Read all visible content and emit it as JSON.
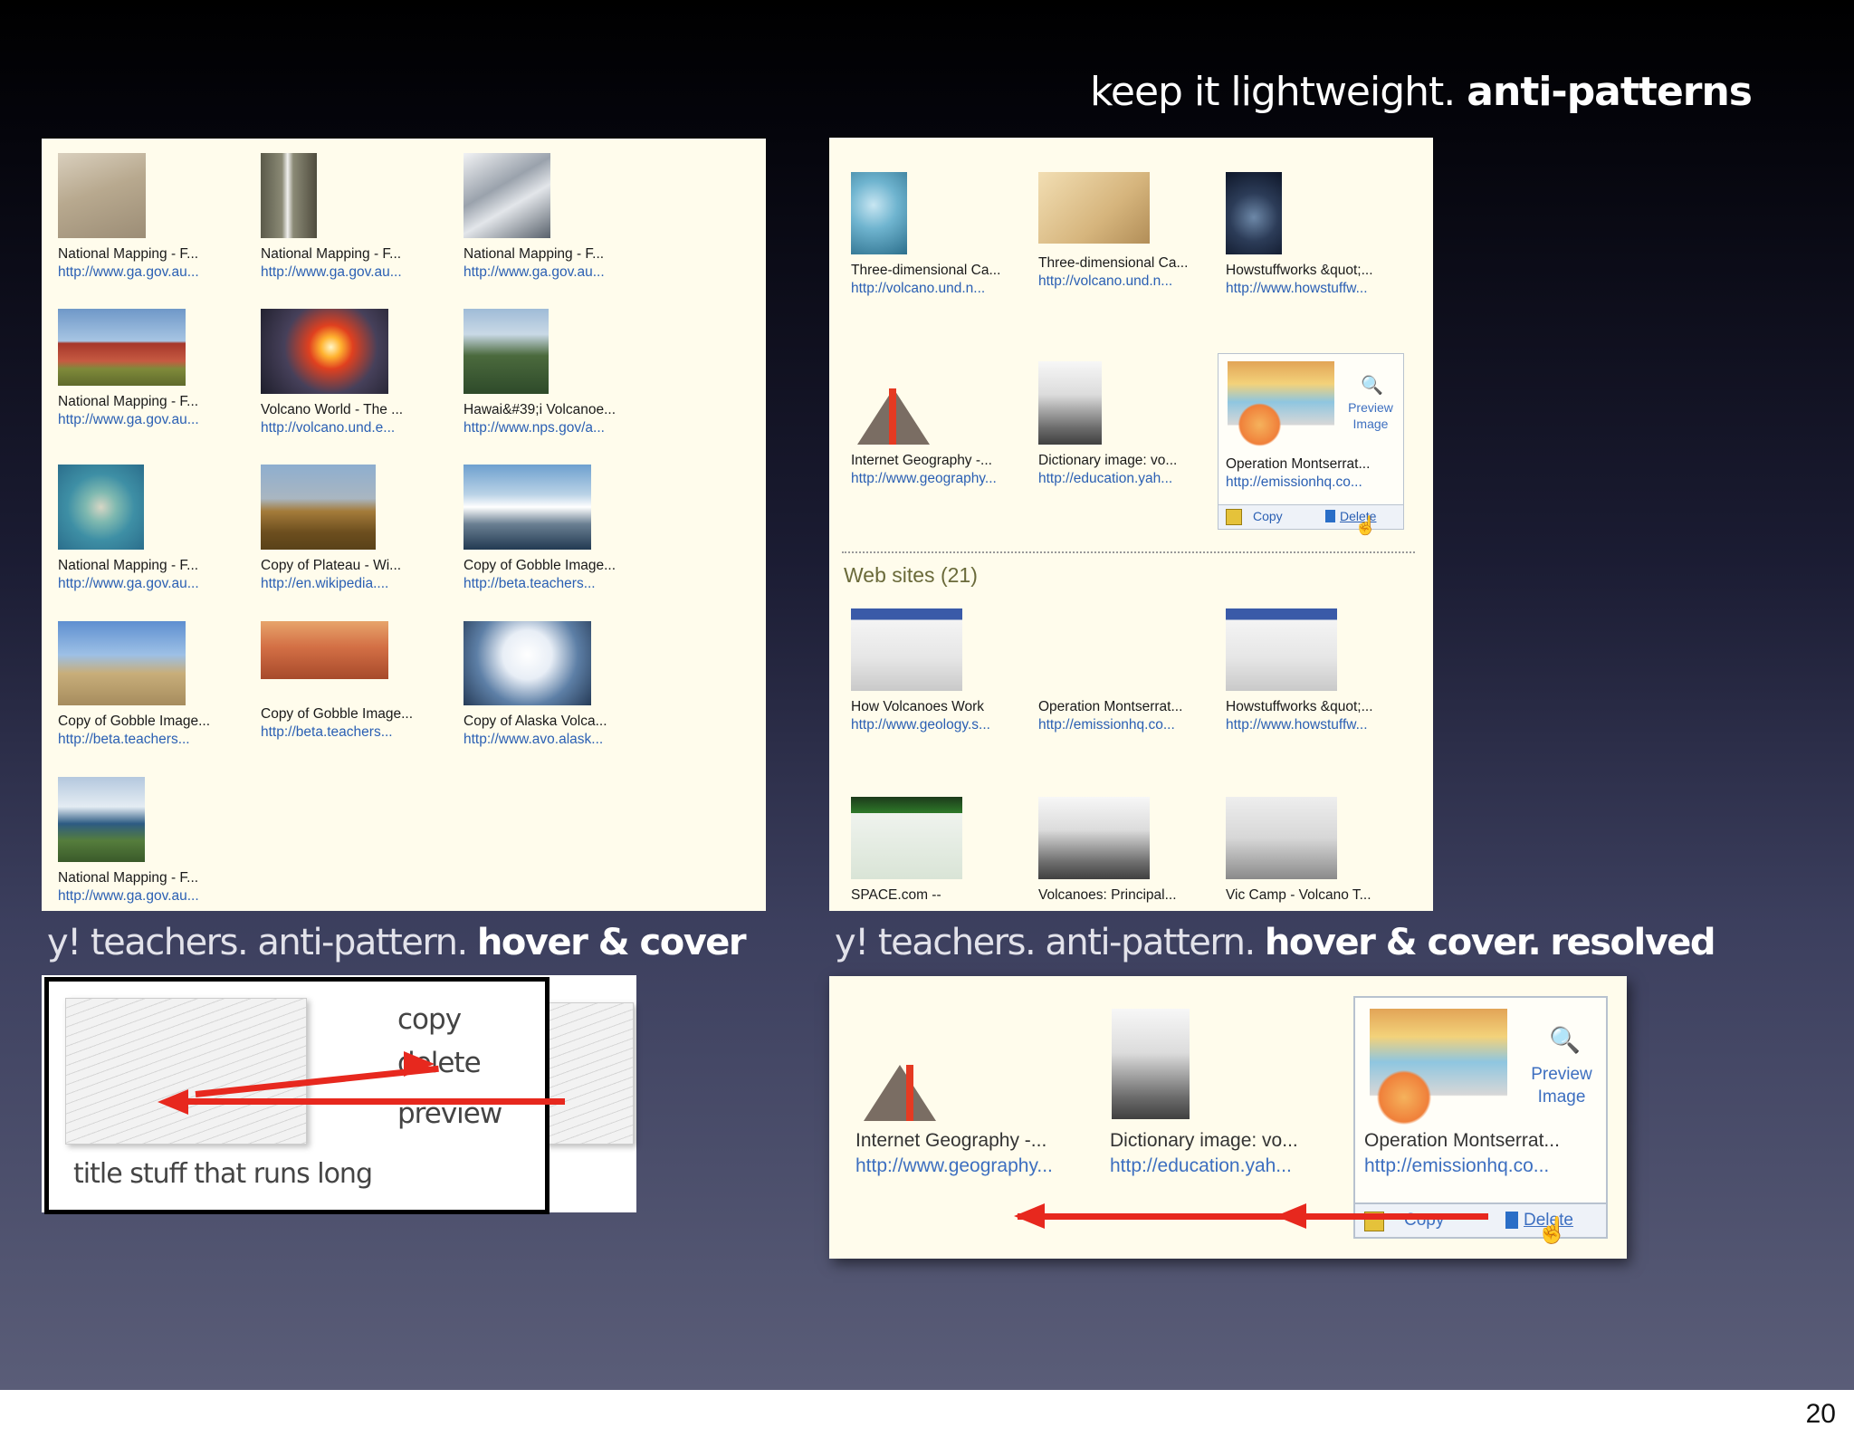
{
  "slide": {
    "title_light": "keep it lightweight.",
    "title_bold": "anti-patterns",
    "page_number": "20"
  },
  "captions": {
    "left_light": "y! teachers. anti-pattern.",
    "left_bold": "hover & cover",
    "right_light": "y! teachers. anti-pattern.",
    "right_mid": "hover & cover.",
    "right_bold": "resolved"
  },
  "left_panel": {
    "tiles": [
      {
        "title": "National Mapping - F...",
        "url": "http://www.ga.gov.au..."
      },
      {
        "title": "National Mapping - F...",
        "url": "http://www.ga.gov.au..."
      },
      {
        "title": "National Mapping - F...",
        "url": "http://www.ga.gov.au..."
      },
      {
        "title": "National Mapping - F...",
        "url": "http://www.ga.gov.au..."
      },
      {
        "title": "Volcano World - The ...",
        "url": "http://volcano.und.e..."
      },
      {
        "title": "Hawai&#39;i Volcanoe...",
        "url": "http://www.nps.gov/a..."
      },
      {
        "title": "National Mapping - F...",
        "url": "http://www.ga.gov.au..."
      },
      {
        "title": "Copy of Plateau - Wi...",
        "url": "http://en.wikipedia...."
      },
      {
        "title": "Copy of Gobble Image...",
        "url": "http://beta.teachers..."
      },
      {
        "title": "Copy of Gobble Image...",
        "url": "http://beta.teachers..."
      },
      {
        "title": "Copy of Gobble Image...",
        "url": "http://beta.teachers..."
      },
      {
        "title": "Copy of Alaska Volca...",
        "url": "http://www.avo.alask..."
      },
      {
        "title": "National Mapping - F...",
        "url": "http://www.ga.gov.au..."
      }
    ]
  },
  "right_panel": {
    "tiles": [
      {
        "title": "Three-dimensional Ca...",
        "url": "http://volcano.und.n..."
      },
      {
        "title": "Three-dimensional Ca...",
        "url": "http://volcano.und.n..."
      },
      {
        "title": "Howstuffworks &quot;...",
        "url": "http://www.howstuffw..."
      },
      {
        "title": "Internet Geography -...",
        "url": "http://www.geography..."
      },
      {
        "title": "Dictionary image: vo...",
        "url": "http://education.yah..."
      },
      {
        "title": "Operation Montserrat...",
        "url": "http://emissionhq.co..."
      }
    ],
    "preview_label_1": "Preview",
    "preview_label_2": "Image",
    "copy_label": "Copy",
    "delete_label": "Delete",
    "web_sites_heading": "Web sites (21)",
    "web_tiles": [
      {
        "title": "How Volcanoes Work",
        "url": "http://www.geology.s..."
      },
      {
        "title": "Operation Montserrat...",
        "url": "http://emissionhq.co..."
      },
      {
        "title": "Howstuffworks &quot;...",
        "url": "http://www.howstuffw..."
      },
      {
        "title": "SPACE.com --",
        "url": ""
      },
      {
        "title": "Volcanoes: Principal...",
        "url": ""
      },
      {
        "title": "Vic Camp - Volcano T...",
        "url": ""
      }
    ]
  },
  "sketch": {
    "copy": "copy",
    "delete": "delete",
    "preview": "preview",
    "title": "title stuff that runs long"
  },
  "zoom": {
    "items": [
      {
        "title": "Internet Geography -...",
        "url": "http://www.geography..."
      },
      {
        "title": "Dictionary image: vo...",
        "url": "http://education.yah..."
      },
      {
        "title": "Operation Montserrat...",
        "url": "http://emissionhq.co..."
      }
    ],
    "preview_label_1": "Preview",
    "preview_label_2": "Image",
    "copy_label": "Copy",
    "delete_label": "Delete"
  },
  "colors": {
    "arrow": "#e7281e",
    "link": "#2a5fb3",
    "panel_bg": "#fffcec"
  }
}
